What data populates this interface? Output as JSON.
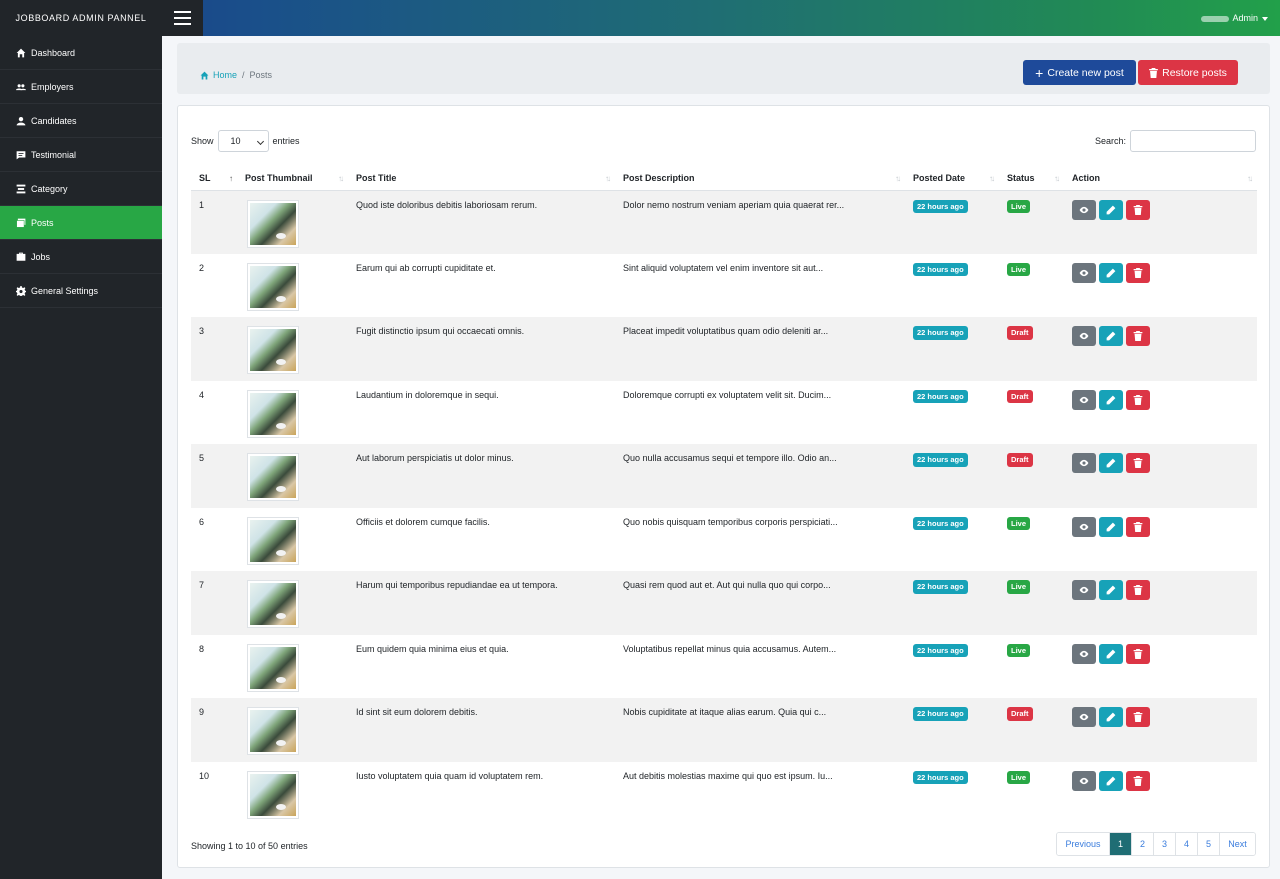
{
  "brand": "JOBBOARD ADMIN PANNEL",
  "user_menu": {
    "label": "Admin"
  },
  "sidebar": {
    "items": [
      {
        "label": "Dashboard",
        "icon": "home-icon"
      },
      {
        "label": "Employers",
        "icon": "users-icon"
      },
      {
        "label": "Candidates",
        "icon": "user-icon"
      },
      {
        "label": "Testimonial",
        "icon": "comment-icon"
      },
      {
        "label": "Category",
        "icon": "stack-icon"
      },
      {
        "label": "Posts",
        "icon": "images-icon",
        "active": true
      },
      {
        "label": "Jobs",
        "icon": "briefcase-icon"
      },
      {
        "label": "General Settings",
        "icon": "gear-icon"
      }
    ]
  },
  "breadcrumb": {
    "home": "Home",
    "current": "Posts"
  },
  "buttons": {
    "create": "Create new post",
    "restore": "Restore posts"
  },
  "table_controls": {
    "show": "Show",
    "entries_value": "10",
    "entries": "entries",
    "search_label": "Search:"
  },
  "table": {
    "columns": [
      "SL",
      "Post Thumbnail",
      "Post Title",
      "Post Description",
      "Posted Date",
      "Status",
      "Action"
    ],
    "rows": [
      {
        "sl": "1",
        "title": "Quod iste doloribus debitis laboriosam rerum.",
        "description": "Dolor nemo nostrum veniam aperiam quia quaerat rer...",
        "date": "22 hours ago",
        "status": "Live"
      },
      {
        "sl": "2",
        "title": "Earum qui ab corrupti cupiditate et.",
        "description": "Sint aliquid voluptatem vel enim inventore sit aut...",
        "date": "22 hours ago",
        "status": "Live"
      },
      {
        "sl": "3",
        "title": "Fugit distinctio ipsum qui occaecati omnis.",
        "description": "Placeat impedit voluptatibus quam odio deleniti ar...",
        "date": "22 hours ago",
        "status": "Draft"
      },
      {
        "sl": "4",
        "title": "Laudantium in doloremque in sequi.",
        "description": "Doloremque corrupti ex voluptatem velit sit. Ducim...",
        "date": "22 hours ago",
        "status": "Draft"
      },
      {
        "sl": "5",
        "title": "Aut laborum perspiciatis ut dolor minus.",
        "description": "Quo nulla accusamus sequi et tempore illo. Odio an...",
        "date": "22 hours ago",
        "status": "Draft"
      },
      {
        "sl": "6",
        "title": "Officiis et dolorem cumque facilis.",
        "description": "Quo nobis quisquam temporibus corporis perspiciati...",
        "date": "22 hours ago",
        "status": "Live"
      },
      {
        "sl": "7",
        "title": "Harum qui temporibus repudiandae ea ut tempora.",
        "description": "Quasi rem quod aut et. Aut qui nulla quo qui corpo...",
        "date": "22 hours ago",
        "status": "Live"
      },
      {
        "sl": "8",
        "title": "Eum quidem quia minima eius et quia.",
        "description": "Voluptatibus repellat minus quia accusamus. Autem...",
        "date": "22 hours ago",
        "status": "Live"
      },
      {
        "sl": "9",
        "title": "Id sint sit eum dolorem debitis.",
        "description": "Nobis cupiditate at itaque alias earum. Quia qui c...",
        "date": "22 hours ago",
        "status": "Draft"
      },
      {
        "sl": "10",
        "title": "Iusto voluptatem quia quam id voluptatem rem.",
        "description": "Aut debitis molestias maxime qui quo est ipsum. Iu...",
        "date": "22 hours ago",
        "status": "Live"
      }
    ]
  },
  "footer": {
    "info": "Showing 1 to 10 of 50 entries",
    "pagination": {
      "previous": "Previous",
      "pages": [
        "1",
        "2",
        "3",
        "4",
        "5"
      ],
      "next": "Next",
      "active": "1"
    }
  },
  "colors": {
    "sidebar_bg": "#212529",
    "active": "#28a745",
    "primary": "#1e4a9a",
    "danger": "#dc3545",
    "info": "#17a2b8"
  }
}
